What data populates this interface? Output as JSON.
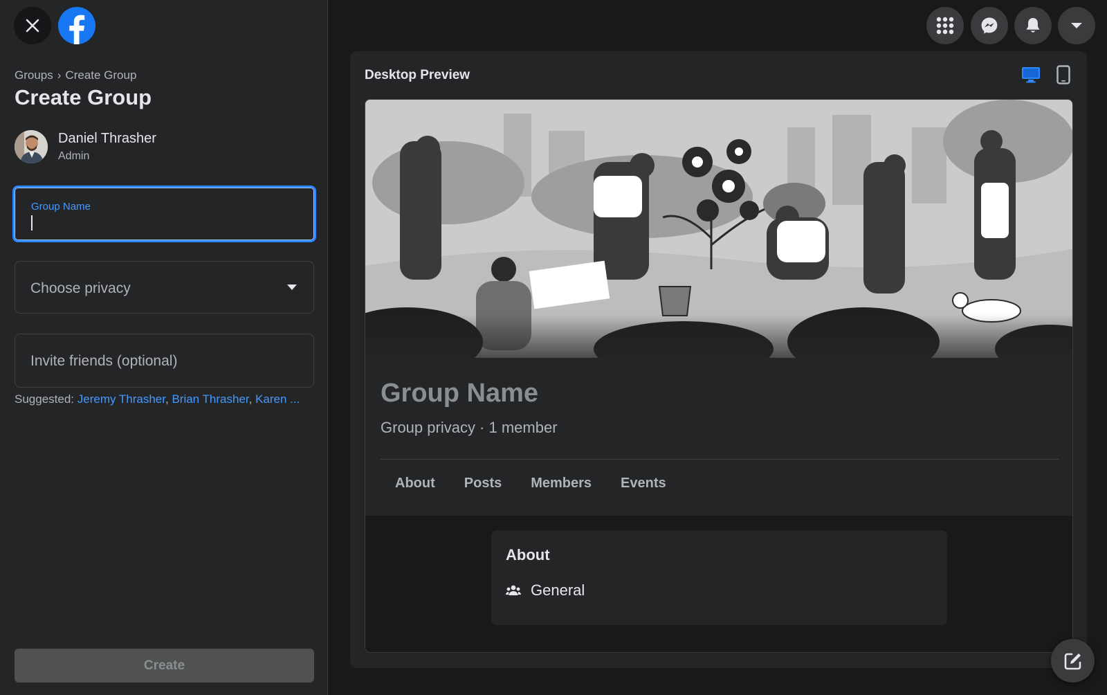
{
  "sidebar": {
    "breadcrumb": {
      "groups": "Groups",
      "separator": "›",
      "current": "Create Group"
    },
    "title": "Create Group",
    "admin": {
      "name": "Daniel Thrasher",
      "role": "Admin"
    },
    "group_name_field": {
      "label": "Group Name",
      "value": ""
    },
    "privacy_select": {
      "placeholder": "Choose privacy"
    },
    "invite_field": {
      "placeholder": "Invite friends (optional)"
    },
    "suggested": {
      "label": "Suggested:",
      "friends": [
        "Jeremy Thrasher",
        "Brian Thrasher",
        "Karen ..."
      ]
    },
    "create_label": "Create"
  },
  "topbar": {
    "icons": [
      "menu-grid-icon",
      "messenger-icon",
      "notifications-bell-icon",
      "account-dropdown-icon"
    ]
  },
  "preview": {
    "title": "Desktop Preview",
    "group_name": "Group Name",
    "group_meta": "Group privacy · 1 member",
    "tabs": [
      "About",
      "Posts",
      "Members",
      "Events"
    ],
    "about_card": {
      "title": "About",
      "item": "General"
    }
  },
  "colors": {
    "accent": "#2d88ff",
    "link": "#4599ff",
    "background": "#18191a",
    "panel": "#242526"
  }
}
